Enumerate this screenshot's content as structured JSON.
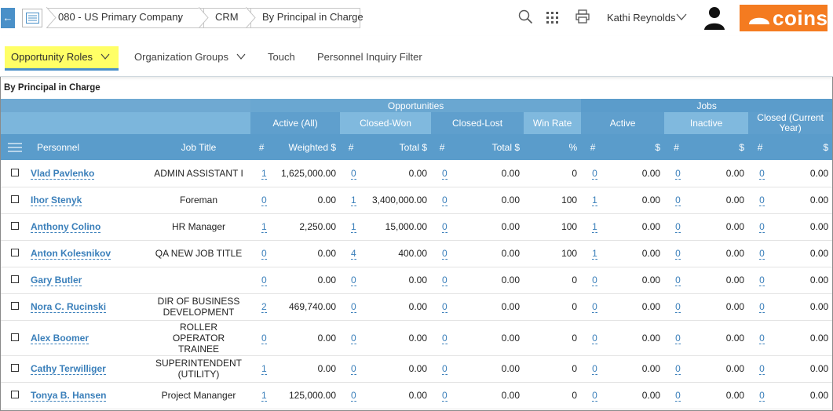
{
  "breadcrumb": {
    "company": "080 - US Primary Company",
    "module": "CRM",
    "page": "By Principal in Charge"
  },
  "header": {
    "user_name": "Kathi Reynolds",
    "logo_text": "COINS"
  },
  "tabs": [
    {
      "label": "Opportunity Roles",
      "active": true,
      "has_dropdown": true
    },
    {
      "label": "Organization Groups",
      "active": false,
      "has_dropdown": true
    },
    {
      "label": "Touch",
      "active": false,
      "has_dropdown": false
    },
    {
      "label": "Personnel Inquiry Filter",
      "active": false,
      "has_dropdown": false
    }
  ],
  "section_title": "By Principal in Charge",
  "table": {
    "group_headers": {
      "opportunities": "Opportunities",
      "jobs": "Jobs"
    },
    "sub_headers": {
      "active_all": "Active (All)",
      "closed_won": "Closed-Won",
      "closed_lost": "Closed-Lost",
      "win_rate": "Win Rate",
      "active": "Active",
      "inactive": "Inactive",
      "closed_current_year": "Closed (Current Year)"
    },
    "columns": {
      "personnel": "Personnel",
      "job_title": "Job Title",
      "count": "#",
      "weighted": "Weighted $",
      "total": "Total $",
      "percent": "%",
      "dollar": "$"
    },
    "rows": [
      {
        "name": "Vlad Pavlenko",
        "title": "ADMIN ASSISTANT I",
        "active_n": "1",
        "weighted": "1,625,000.00",
        "won_n": "0",
        "won_total": "0.00",
        "lost_n": "0",
        "lost_total": "0.00",
        "win_rate": "0",
        "jobs_active_n": "0",
        "jobs_active_amt": "0.00",
        "jobs_inactive_n": "0",
        "jobs_inactive_amt": "0.00",
        "jobs_closed_n": "0",
        "jobs_closed_amt": "0.00"
      },
      {
        "name": "Ihor Stenyk",
        "title": "Foreman",
        "active_n": "0",
        "weighted": "0.00",
        "won_n": "1",
        "won_total": "3,400,000.00",
        "lost_n": "0",
        "lost_total": "0.00",
        "win_rate": "100",
        "jobs_active_n": "1",
        "jobs_active_amt": "0.00",
        "jobs_inactive_n": "0",
        "jobs_inactive_amt": "0.00",
        "jobs_closed_n": "0",
        "jobs_closed_amt": "0.00"
      },
      {
        "name": "Anthony Colino",
        "title": "HR Manager",
        "active_n": "1",
        "weighted": "2,250.00",
        "won_n": "1",
        "won_total": "15,000.00",
        "lost_n": "0",
        "lost_total": "0.00",
        "win_rate": "100",
        "jobs_active_n": "1",
        "jobs_active_amt": "0.00",
        "jobs_inactive_n": "0",
        "jobs_inactive_amt": "0.00",
        "jobs_closed_n": "0",
        "jobs_closed_amt": "0.00"
      },
      {
        "name": "Anton Kolesnikov",
        "title": "QA NEW JOB TITLE",
        "active_n": "0",
        "weighted": "0.00",
        "won_n": "4",
        "won_total": "400.00",
        "lost_n": "0",
        "lost_total": "0.00",
        "win_rate": "100",
        "jobs_active_n": "1",
        "jobs_active_amt": "0.00",
        "jobs_inactive_n": "0",
        "jobs_inactive_amt": "0.00",
        "jobs_closed_n": "0",
        "jobs_closed_amt": "0.00"
      },
      {
        "name": "Gary Butler",
        "title": "",
        "active_n": "0",
        "weighted": "0.00",
        "won_n": "0",
        "won_total": "0.00",
        "lost_n": "0",
        "lost_total": "0.00",
        "win_rate": "0",
        "jobs_active_n": "0",
        "jobs_active_amt": "0.00",
        "jobs_inactive_n": "0",
        "jobs_inactive_amt": "0.00",
        "jobs_closed_n": "0",
        "jobs_closed_amt": "0.00"
      },
      {
        "name": "Nora C. Rucinski",
        "title": "DIR OF BUSINESS DEVELOPMENT",
        "active_n": "2",
        "weighted": "469,740.00",
        "won_n": "0",
        "won_total": "0.00",
        "lost_n": "0",
        "lost_total": "0.00",
        "win_rate": "0",
        "jobs_active_n": "0",
        "jobs_active_amt": "0.00",
        "jobs_inactive_n": "0",
        "jobs_inactive_amt": "0.00",
        "jobs_closed_n": "0",
        "jobs_closed_amt": "0.00"
      },
      {
        "name": "Alex Boomer",
        "title": "ROLLER OPERATOR TRAINEE",
        "active_n": "0",
        "weighted": "0.00",
        "won_n": "0",
        "won_total": "0.00",
        "lost_n": "0",
        "lost_total": "0.00",
        "win_rate": "0",
        "jobs_active_n": "0",
        "jobs_active_amt": "0.00",
        "jobs_inactive_n": "0",
        "jobs_inactive_amt": "0.00",
        "jobs_closed_n": "0",
        "jobs_closed_amt": "0.00"
      },
      {
        "name": "Cathy Terwilliger",
        "title": "SUPERINTENDENT (UTILITY)",
        "active_n": "1",
        "weighted": "0.00",
        "won_n": "0",
        "won_total": "0.00",
        "lost_n": "0",
        "lost_total": "0.00",
        "win_rate": "0",
        "jobs_active_n": "0",
        "jobs_active_amt": "0.00",
        "jobs_inactive_n": "0",
        "jobs_inactive_amt": "0.00",
        "jobs_closed_n": "0",
        "jobs_closed_amt": "0.00"
      },
      {
        "name": "Tonya B. Hansen",
        "title": "Project Mananger",
        "active_n": "1",
        "weighted": "125,000.00",
        "won_n": "0",
        "won_total": "0.00",
        "lost_n": "0",
        "lost_total": "0.00",
        "win_rate": "0",
        "jobs_active_n": "0",
        "jobs_active_amt": "0.00",
        "jobs_inactive_n": "0",
        "jobs_inactive_amt": "0.00",
        "jobs_closed_n": "0",
        "jobs_closed_amt": "0.00"
      }
    ]
  },
  "colors": {
    "accent": "#4a90c8",
    "header_blue": "#6fa9d2",
    "active_tab_highlight": "#ffff66",
    "logo_orange": "#f47b20",
    "link": "#3a7fba"
  },
  "icons": [
    "back-arrow-icon",
    "list-icon",
    "down-arrow-icon",
    "search-icon",
    "apps-grid-icon",
    "print-icon",
    "chevron-down-icon",
    "user-avatar-icon",
    "menu-icon"
  ]
}
